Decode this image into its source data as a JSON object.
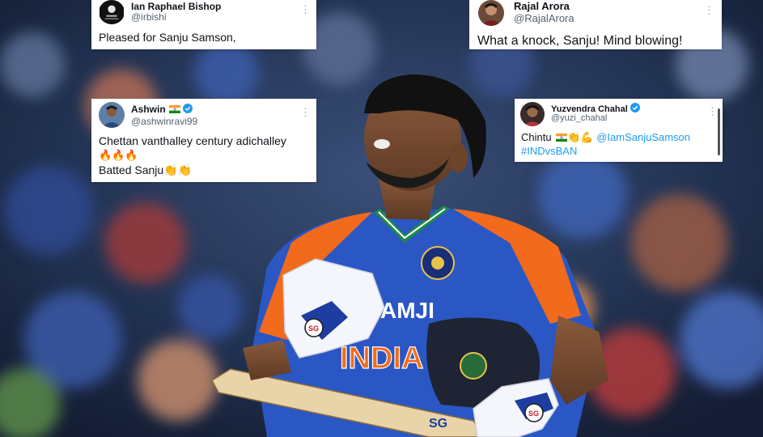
{
  "tweets": [
    {
      "id": "bishop",
      "name": "Ian Raphael Bishop",
      "handle": "@irbishi",
      "text": "Pleased for Sanju Samson,"
    },
    {
      "id": "rajal",
      "name": "Rajal Arora",
      "handle": "@RajalArora",
      "text": "What a knock, Sanju! Mind blowing!"
    },
    {
      "id": "ashwin",
      "name": "Ashwin",
      "handle": "@ashwinravi99",
      "line1": "Chettan vanthalley century adichalley",
      "line2": "🔥🔥🔥",
      "line3": "Batted Sanju👏👏",
      "verified": true
    },
    {
      "id": "chahal",
      "name": "Yuzvendra Chahal",
      "handle": "@yuzi_chahal",
      "prefix": "Chintu",
      "emoji": "👏💪",
      "mention": "@IamSanjuSamson",
      "hashtag": "#INDvsBAN",
      "verified": true
    }
  ],
  "photo": {
    "jersey_text_top": "AMJI",
    "jersey_text_main": "INDIA",
    "glove_brand": "SG"
  },
  "colors": {
    "link": "#1d9bf0",
    "verified": "#1d9bf0",
    "jersey_blue": "#2b57c4",
    "jersey_orange": "#f26a1b"
  },
  "icons": [
    "more-icon",
    "verified-icon",
    "india-flag-icon"
  ]
}
